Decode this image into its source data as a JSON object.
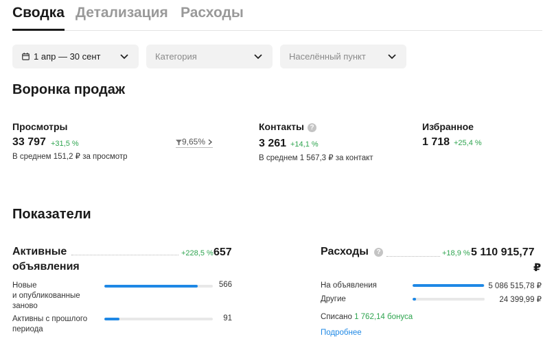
{
  "tabs": [
    {
      "label": "Сводка"
    },
    {
      "label": "Детализация"
    },
    {
      "label": "Расходы"
    }
  ],
  "filters": {
    "date": "1 апр — 30 сент",
    "category_placeholder": "Категория",
    "locality_placeholder": "Населённый пункт"
  },
  "funnel": {
    "title": "Воронка продаж",
    "views": {
      "label": "Просмотры",
      "value": "33 797",
      "delta": "+31,5 %",
      "sub": "В среднем 151,2 ₽ за просмотр"
    },
    "conversion": "9,65%",
    "contacts": {
      "label": "Контакты",
      "value": "3 261",
      "delta": "+14,1 %",
      "sub": "В среднем 1 567,3 ₽ за контакт"
    },
    "favorites": {
      "label": "Избранное",
      "value": "1 718",
      "delta": "+25,4 %"
    }
  },
  "indicators": {
    "title": "Показатели",
    "active": {
      "label_line1": "Активные",
      "label_line2": "объявления",
      "delta": "+228,5 %",
      "value": "657",
      "rows": [
        {
          "label_lines": [
            "Новые",
            "и опубликованные",
            "заново"
          ],
          "value": "566",
          "fraction": 0.86
        },
        {
          "label_lines": [
            "Активны с прошлого",
            "периода"
          ],
          "value": "91",
          "fraction": 0.14
        }
      ]
    },
    "expenses": {
      "label": "Расходы",
      "delta": "+18,9 %",
      "value": "5 110 915,77",
      "currency": "₽",
      "rows": [
        {
          "label": "На объявления",
          "value": "5 086 515,78 ₽",
          "fraction": 0.995
        },
        {
          "label": "Другие",
          "value": "24 399,99 ₽",
          "fraction": 0.05
        }
      ],
      "written_off_prefix": "Списано",
      "written_off_bonus": "1 762,14 бонуса",
      "more_link": "Подробнее"
    }
  },
  "colors": {
    "accent": "#1e88e5",
    "positive": "#2ea44f"
  }
}
